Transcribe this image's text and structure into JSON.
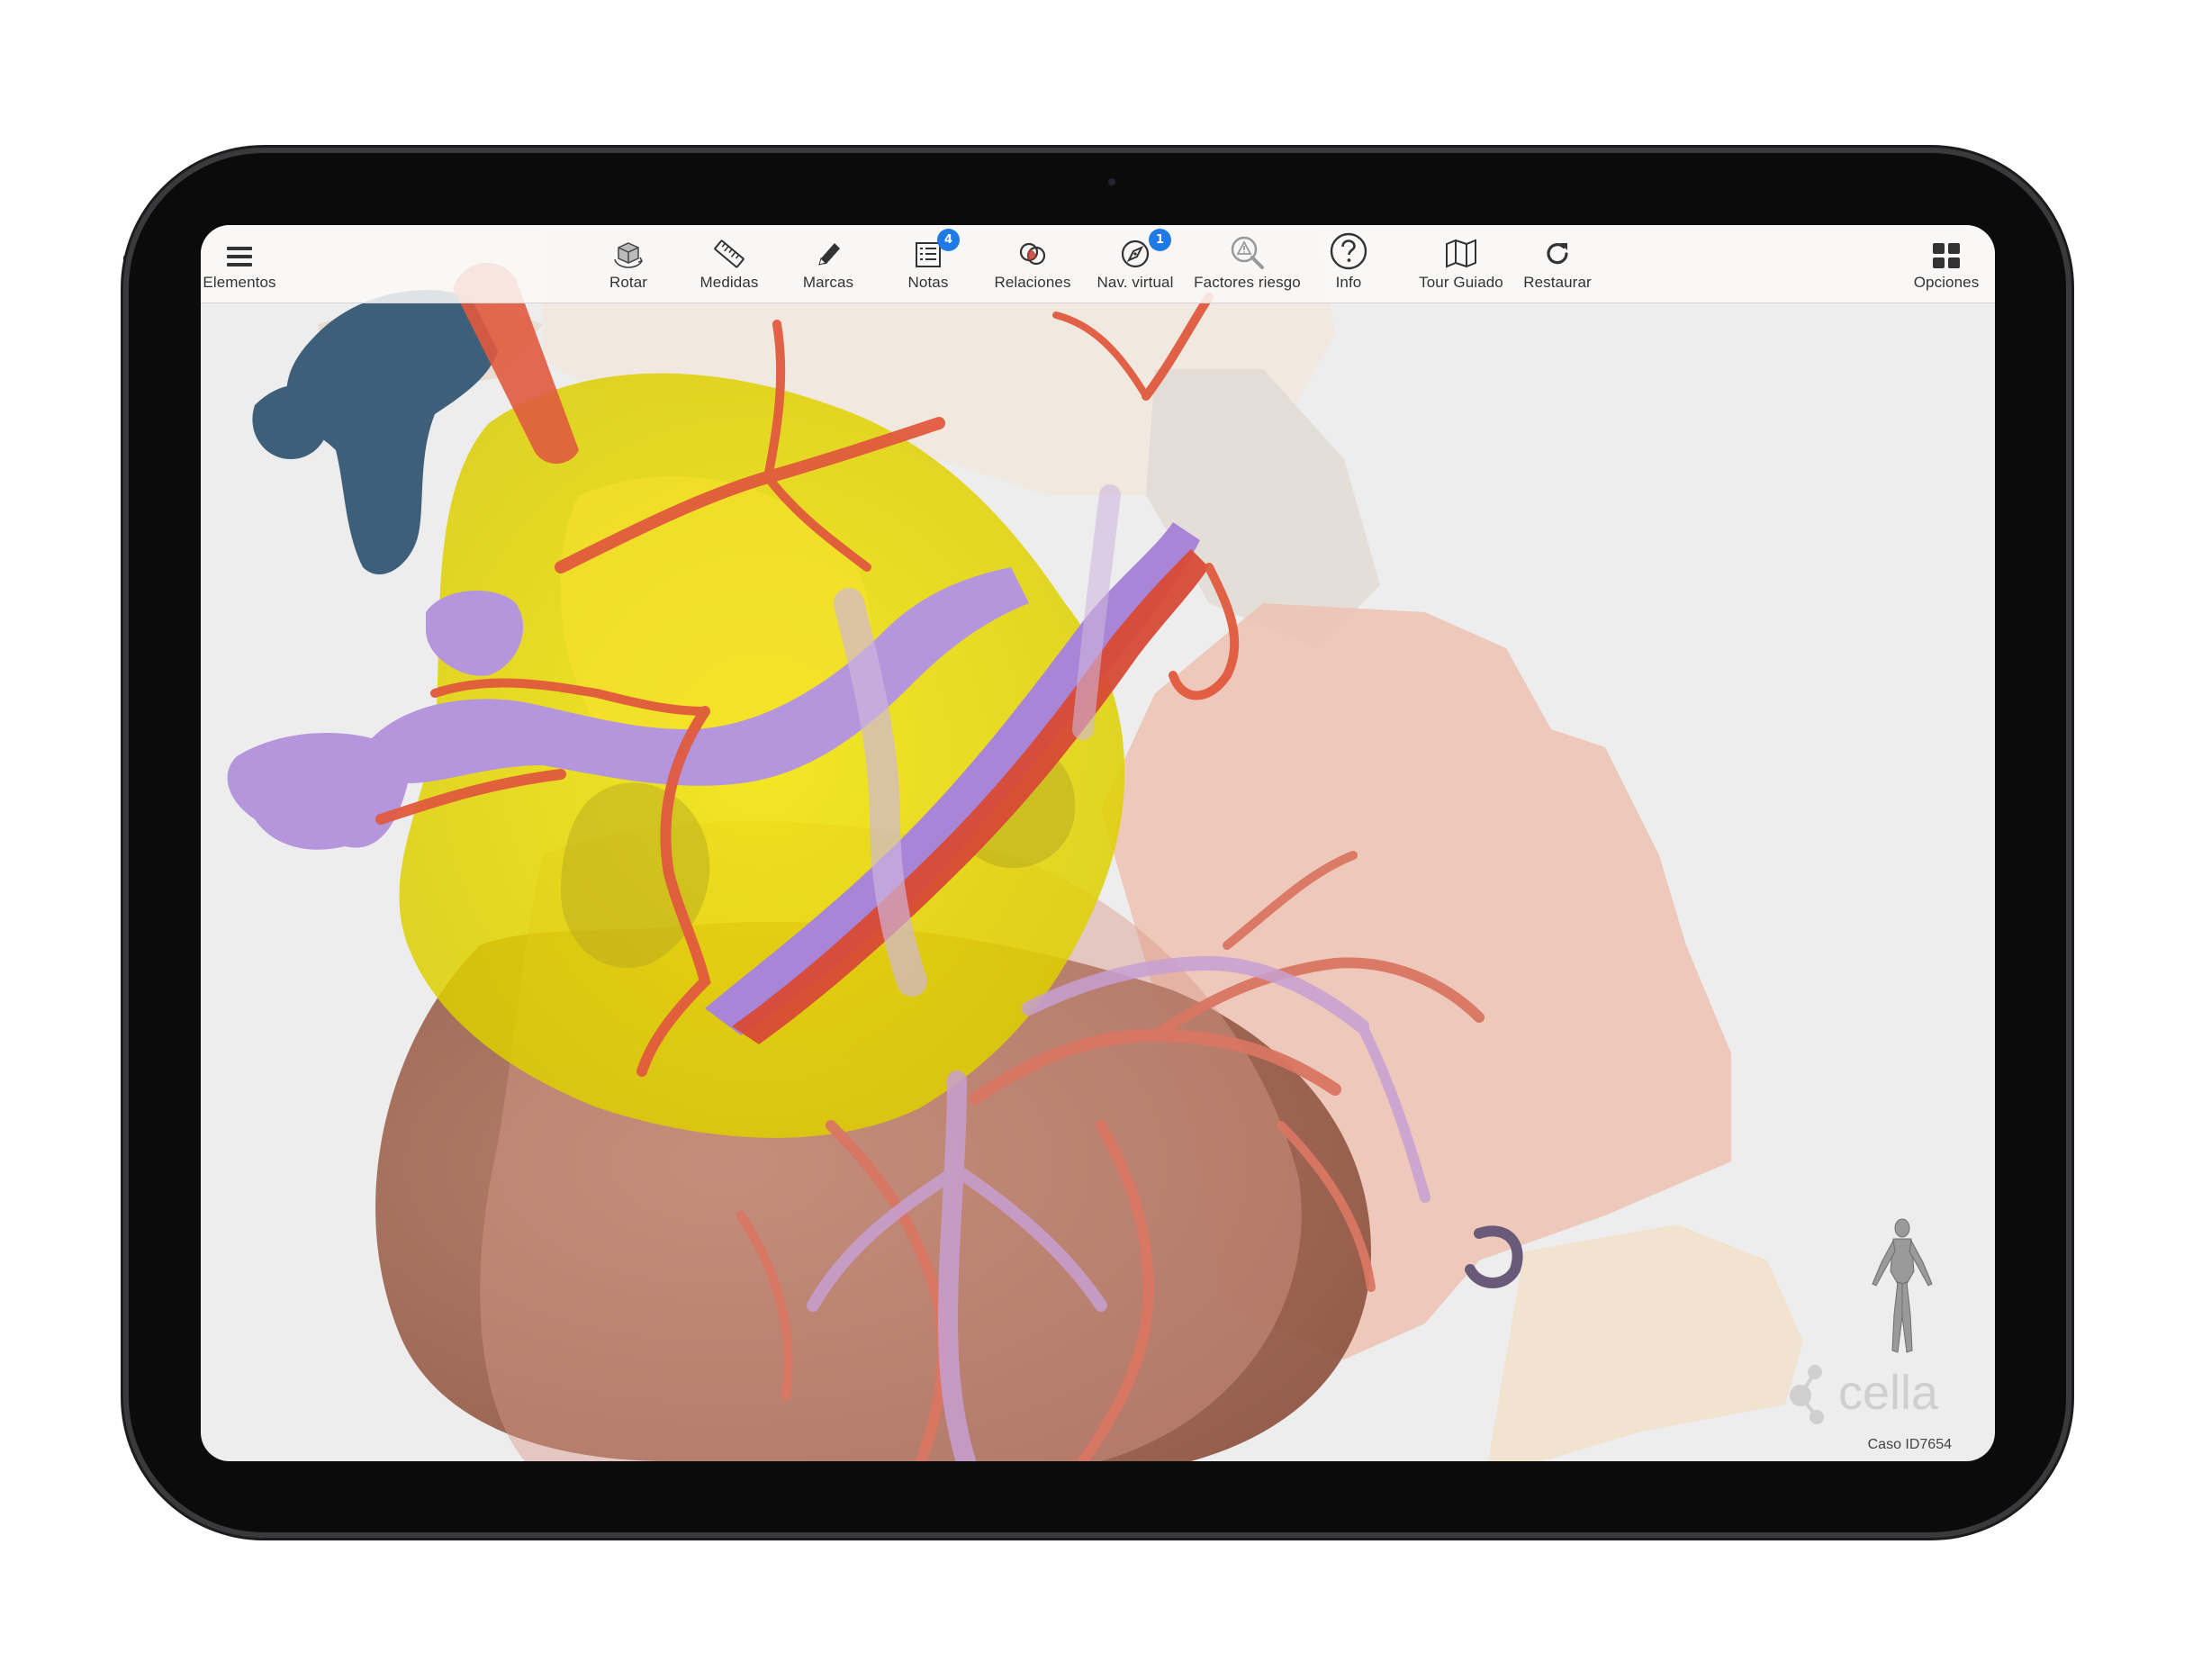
{
  "toolbar": {
    "menu": {
      "label": "Elementos",
      "icon": "hamburger-menu-icon"
    },
    "tools": [
      {
        "label": "Rotar",
        "icon": "rotate-cube-icon"
      },
      {
        "label": "Medidas",
        "icon": "ruler-icon"
      },
      {
        "label": "Marcas",
        "icon": "pencil-icon"
      },
      {
        "label": "Notas",
        "icon": "notes-list-icon",
        "badge": "4"
      },
      {
        "label": "Relaciones",
        "icon": "overlapping-circles-icon"
      },
      {
        "label": "Nav. virtual",
        "icon": "compass-icon",
        "badge": "1"
      },
      {
        "label": "Factores riesgo",
        "icon": "risk-magnifier-icon"
      },
      {
        "label": "Info",
        "icon": "help-circle-icon"
      },
      {
        "label": "Tour Guiado",
        "icon": "map-icon"
      },
      {
        "label": "Restaurar",
        "icon": "refresh-icon"
      }
    ],
    "options": {
      "label": "Opciones",
      "icon": "grid-icon"
    }
  },
  "viewer": {
    "brand": "cella",
    "case_id": "Caso ID7654",
    "orientation_icon": "human-figure-icon"
  },
  "colors": {
    "accent": "#1f7ae6",
    "background": "#ededed",
    "tumor_yellow": "#e5d800",
    "vein_purple": "#b596dd",
    "artery_red": "#e05a3e",
    "portal_vein_blue": "#3e5f7a"
  }
}
